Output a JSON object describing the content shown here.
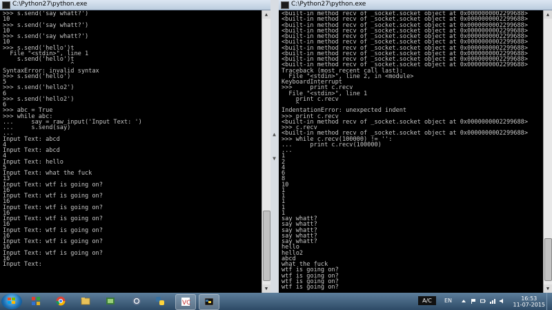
{
  "left_window": {
    "title": "C:\\Python27\\python.exe",
    "lines": [
      ">>> s.send('say whatt?')",
      "10",
      ">>> s.send('say whatt?')",
      "10",
      ">>> s.send('say whatt?')",
      "10",
      ">>> s.send('hello')t",
      "  File \"<stdin>\", line 1",
      "    s.send('hello')t",
      "                   ^",
      "SyntaxError: invalid syntax",
      ">>> s.send('hello')",
      "5",
      ">>> s.send('hello2')",
      "6",
      ">>> s.send('hello2')",
      "6",
      ">>> abc = True",
      ">>> while abc:",
      "...     say = raw_input('Input Text: ')",
      "...     s.send(say)",
      "...",
      "Input Text: abcd",
      "4",
      "Input Text: abcd",
      "4",
      "Input Text: hello",
      "5",
      "Input Text: what the fuck",
      "13",
      "Input Text: wtf is going on?",
      "16",
      "Input Text: wtf is going on?",
      "16",
      "Input Text: wtf is going on?",
      "16",
      "Input Text: wtf is going on?",
      "16",
      "Input Text: wtf is going on?",
      "16",
      "Input Text: wtf is going on?",
      "16",
      "Input Text: wtf is going on?",
      "16",
      "Input Text:"
    ]
  },
  "right_window": {
    "title": "C:\\Python27\\python.exe",
    "lines": [
      "<built-in method recv of _socket.socket object at 0x0000000002299688>",
      "<built-in method recv of _socket.socket object at 0x0000000002299688>",
      "<built-in method recv of _socket.socket object at 0x0000000002299688>",
      "<built-in method recv of _socket.socket object at 0x0000000002299688>",
      "<built-in method recv of _socket.socket object at 0x0000000002299688>",
      "<built-in method recv of _socket.socket object at 0x0000000002299688>",
      "<built-in method recv of _socket.socket object at 0x0000000002299688>",
      "<built-in method recv of _socket.socket object at 0x0000000002299688>",
      "<built-in method recv of _socket.socket object at 0x0000000002299688>",
      "<built-in method recv of _socket.socket object at 0x0000000002299688>",
      "Traceback (most recent call last):",
      "  File \"<stdin>\", line 2, in <module>",
      "KeyboardInterrupt",
      ">>>     print c.recv",
      "  File \"<stdin>\", line 1",
      "    print c.recv",
      "    ^",
      "IndentationError: unexpected indent",
      ">>> print c.recv",
      "<built-in method recv of _socket.socket object at 0x0000000002299688>",
      ">>> c.recv",
      "<built-in method recv of _socket.socket object at 0x0000000002299688>",
      ">>> while c.recv(100000) != '':",
      "...     print c.recv(100000)",
      "...",
      "1",
      "2",
      "4",
      "6",
      "8",
      "10",
      "1",
      "1",
      "1",
      "1",
      "1",
      "say whatt?",
      "say whatt?",
      "say whatt?",
      "say whatt?",
      "say whatt?",
      "hello",
      "hello2",
      "abcd",
      "what the fuck",
      "wtf is going on?",
      "wtf is going on?",
      "wtf is going on?",
      "wtf is going on?"
    ]
  },
  "taskbar": {
    "tray": {
      "ac_label": "A/C",
      "language": "EN",
      "time": "16:53",
      "date": "11-07-2015"
    }
  },
  "colors": {
    "console_bg": "#000000",
    "console_text": "#c8c8c8",
    "taskbar_top": "#5d7e9b",
    "taskbar_bottom": "#2d4a66"
  }
}
